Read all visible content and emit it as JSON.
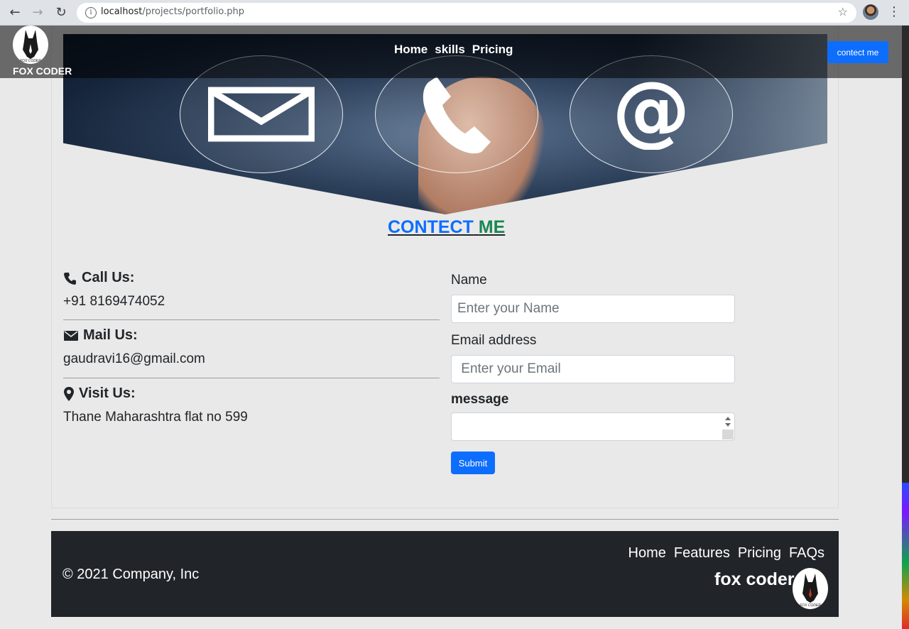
{
  "browser": {
    "url_host": "localhost",
    "url_path": "/projects/portfolio.php",
    "back_icon": "arrow-left-icon",
    "forward_icon": "arrow-right-icon",
    "reload_icon": "reload-icon",
    "info_icon": "info-icon",
    "star_icon": "star-icon",
    "menu_icon": "kebab-menu-icon"
  },
  "navbar": {
    "brand": "FOX CODER",
    "logo_caption": "FOX CODER",
    "links": [
      "Home",
      "skills",
      "Pricing"
    ],
    "cta": "contect me"
  },
  "hero": {
    "icons": [
      "envelope-icon",
      "phone-icon",
      "at-sign-icon"
    ]
  },
  "contact": {
    "title_part1": "CONTECT",
    "title_part2": "ME",
    "call_label": "Call Us:",
    "call_value": "+91 8169474052",
    "mail_label": "Mail Us:",
    "mail_value": "gaudravi16@gmail.com",
    "visit_label": "Visit Us:",
    "visit_value": "Thane Maharashtra flat no 599"
  },
  "form": {
    "name_label": "Name",
    "name_placeholder": "Enter your Name",
    "email_label": "Email address",
    "email_placeholder": " Enter your Email",
    "message_label": "message",
    "submit": "Submit"
  },
  "footer": {
    "copyright": "© 2021 Company, Inc",
    "links": [
      "Home",
      "Features",
      "Pricing",
      "FAQs"
    ],
    "brand": "fox coder",
    "logo_caption": "FOX CODER"
  },
  "colors": {
    "primary": "#0d6efd",
    "success": "#198754",
    "footer_bg": "#212529",
    "page_bg": "#e9e9e9"
  }
}
